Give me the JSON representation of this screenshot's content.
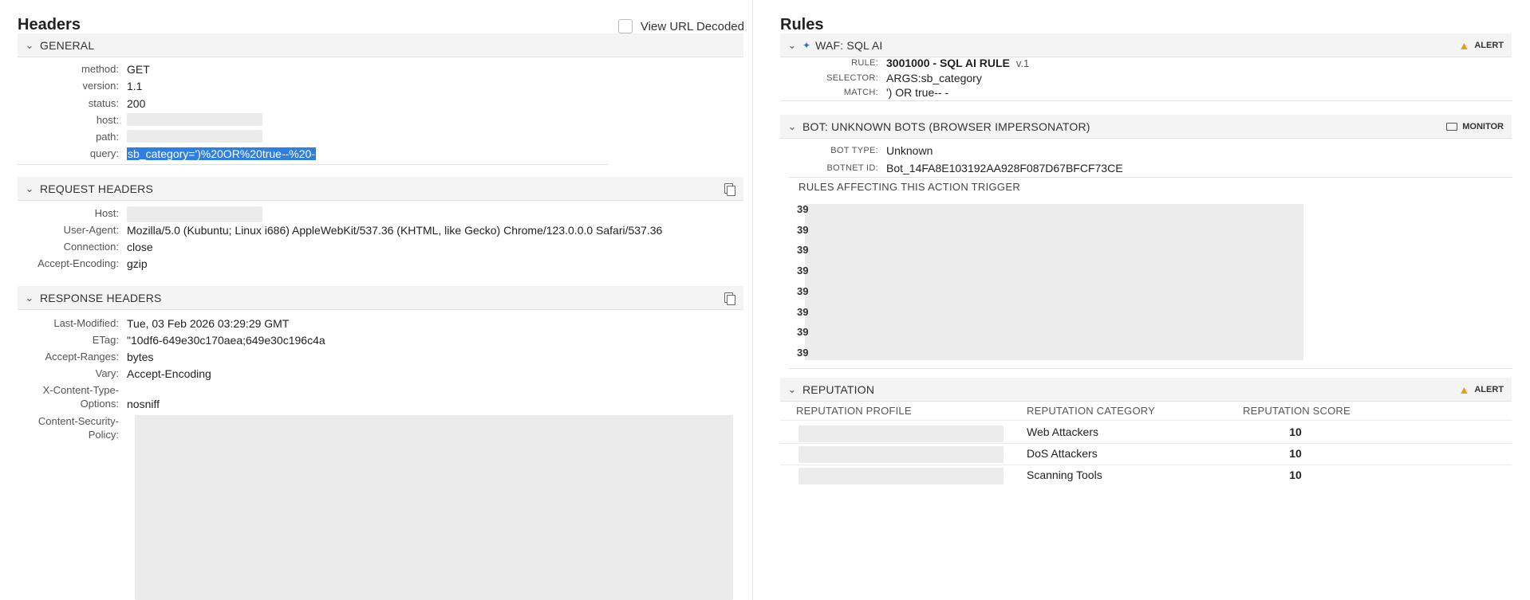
{
  "headers_panel": {
    "title": "Headers",
    "view_url_decoded_label": "View URL Decoded",
    "general": {
      "title": "GENERAL",
      "fields": [
        {
          "key": "method:",
          "value": "GET"
        },
        {
          "key": "version:",
          "value": "1.1"
        },
        {
          "key": "status:",
          "value": "200"
        },
        {
          "key": "host:",
          "value": ""
        },
        {
          "key": "path:",
          "value": ""
        },
        {
          "key": "query:",
          "value": "sb_category=')%20OR%20true--%20-"
        }
      ]
    },
    "request_headers": {
      "title": "REQUEST HEADERS",
      "fields": [
        {
          "key": "Host:",
          "value": ""
        },
        {
          "key": "User-Agent:",
          "value": "Mozilla/5.0 (Kubuntu; Linux i686) AppleWebKit/537.36 (KHTML, like Gecko) Chrome/123.0.0.0 Safari/537.36"
        },
        {
          "key": "Connection:",
          "value": "close"
        },
        {
          "key": "Accept-Encoding:",
          "value": "gzip"
        }
      ]
    },
    "response_headers": {
      "title": "RESPONSE HEADERS",
      "fields": [
        {
          "key": "Last-Modified:",
          "value": "Tue, 03 Feb 2026 03:29:29 GMT"
        },
        {
          "key": "ETag:",
          "value": "\"10df6-649e30c170aea;649e30c196c4a"
        },
        {
          "key": "Accept-Ranges:",
          "value": "bytes"
        },
        {
          "key": "Vary:",
          "value": "Accept-Encoding"
        },
        {
          "key": "X-Content-Type-",
          "value": ""
        },
        {
          "key": "Options:",
          "value": "nosniff"
        },
        {
          "key": "Content-Security-",
          "value": ""
        },
        {
          "key": "Policy:",
          "value": ""
        }
      ]
    }
  },
  "rules_panel": {
    "title": "Rules",
    "waf": {
      "title": "WAF: SQL AI",
      "badge": "ALERT",
      "rule_key": "RULE:",
      "rule_value": "3001000 - SQL AI RULE",
      "rule_version": "v.1",
      "selector_key": "SELECTOR:",
      "selector_value": "ARGS:sb_category",
      "match_key": "MATCH:",
      "match_value": "') OR true-- -"
    },
    "bot": {
      "title": "BOT: UNKNOWN BOTS (BROWSER IMPERSONATOR)",
      "badge": "MONITOR",
      "bot_type_key": "BOT TYPE:",
      "bot_type_value": "Unknown",
      "botnet_id_key": "BOTNET ID:",
      "botnet_id_value": "Bot_14FA8E103192AA928F087D67BFCF73CE",
      "trigger_label": "RULES AFFECTING THIS ACTION TRIGGER",
      "trigger_items": [
        "39",
        "39",
        "39",
        "39",
        "39",
        "39",
        "39",
        "39"
      ]
    },
    "reputation": {
      "title": "REPUTATION",
      "badge": "ALERT",
      "columns": [
        "REPUTATION PROFILE",
        "REPUTATION CATEGORY",
        "REPUTATION SCORE"
      ],
      "rows": [
        {
          "profile": "",
          "category": "Web Attackers",
          "score": "10"
        },
        {
          "profile": "",
          "category": "DoS Attackers",
          "score": "10"
        },
        {
          "profile": "",
          "category": "Scanning Tools",
          "score": "10"
        }
      ]
    }
  },
  "icons": {
    "chevron": "chevron-down-icon",
    "copy": "copy-icon",
    "warning": "warning-icon",
    "monitor": "monitor-icon",
    "sparkle": "sparkle-icon"
  },
  "colors": {
    "highlight": "#2f7fe3",
    "warning": "#e0a11b",
    "section_bg": "#f4f4f4",
    "redaction": "#ececec"
  }
}
